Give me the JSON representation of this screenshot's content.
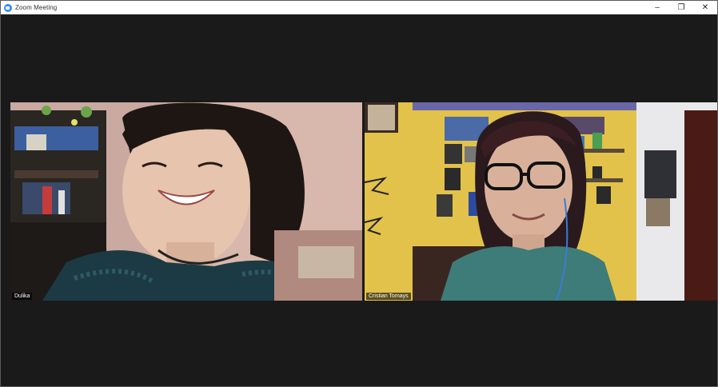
{
  "window": {
    "title": "Zoom Meeting",
    "controls": {
      "minimize": "–",
      "maximize": "❐",
      "close": "✕"
    }
  },
  "participants": [
    {
      "name": "Dulika"
    },
    {
      "name": "Cristian Tomays"
    }
  ],
  "colors": {
    "background": "#1a1a1a",
    "titlebar": "#ffffff",
    "accent": "#2d8cff"
  }
}
